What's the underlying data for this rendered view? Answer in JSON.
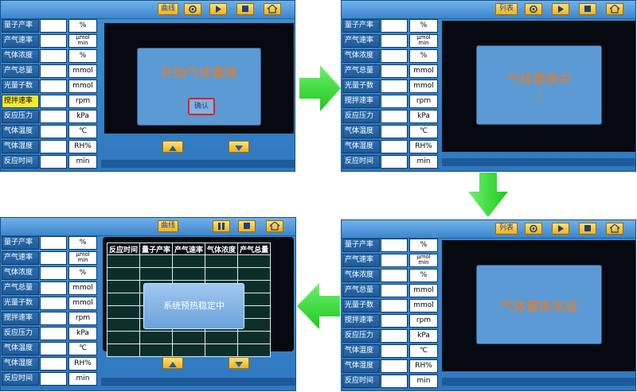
{
  "rows": [
    {
      "label": "量子产率",
      "unit": "%"
    },
    {
      "label": "产气速率",
      "unit_top": "μmol",
      "unit_bottom": "min"
    },
    {
      "label": "气体浓度",
      "unit": "%"
    },
    {
      "label": "产气总量",
      "unit": "mmol"
    },
    {
      "label": "光量子数",
      "unit": "mmol"
    },
    {
      "label": "搅拌速率",
      "unit": "rpm"
    },
    {
      "label": "反应压力",
      "unit": "kPa"
    },
    {
      "label": "气体温度",
      "unit": "℃"
    },
    {
      "label": "气体湿度",
      "unit": "RH%"
    },
    {
      "label": "反应时间",
      "unit": "min"
    }
  ],
  "toolbar": {
    "curve": "曲线",
    "list": "列表"
  },
  "panel1": {
    "message": "开始气体置换",
    "confirm": "确认"
  },
  "panel2": {
    "message": "气体置换中",
    "spinner": "/"
  },
  "panel3": {
    "message": "气体置换完成"
  },
  "panel4": {
    "headers": [
      "反应时间",
      "量子产率",
      "产气速率",
      "气体浓度",
      "产气总量"
    ],
    "message": "系统预热稳定中"
  },
  "colors": {
    "accent_text": "#f07b1a",
    "highlight_label": "#f6ea30",
    "confirm_border": "#e02020",
    "arrow_green": "#39d339"
  }
}
